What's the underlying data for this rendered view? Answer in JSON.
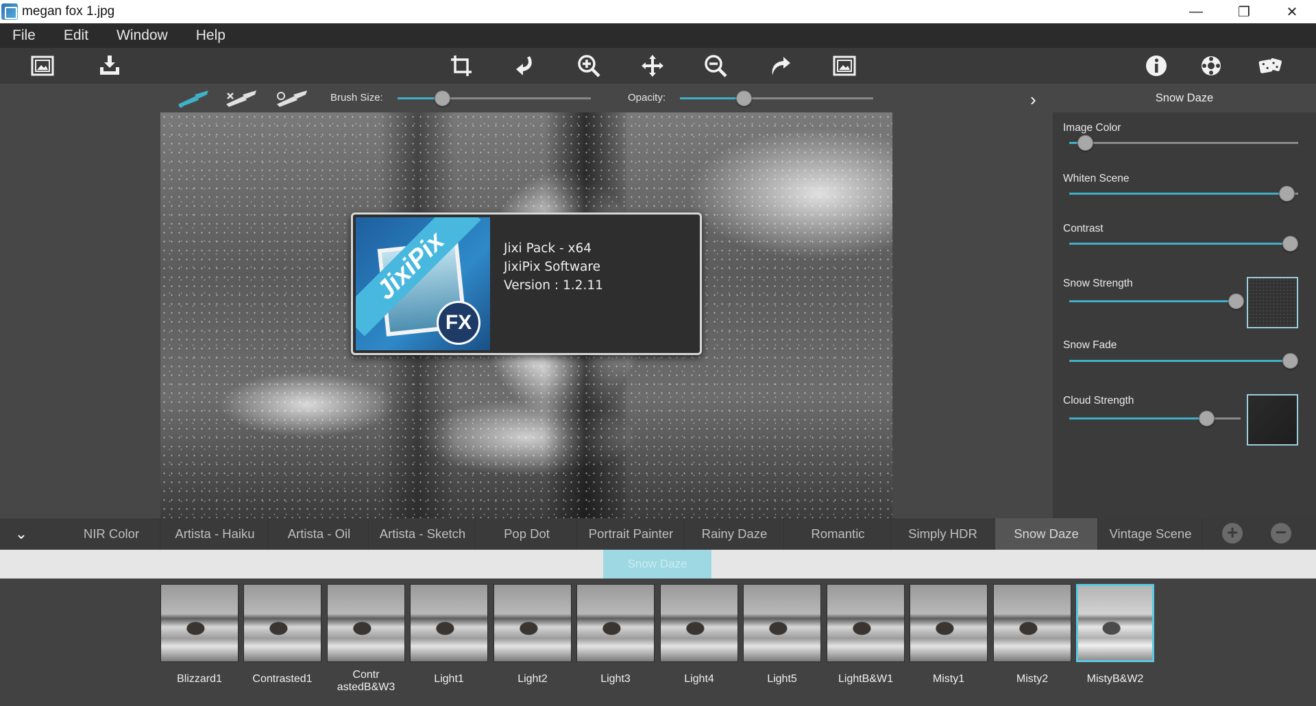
{
  "window": {
    "title": "megan fox 1.jpg",
    "controls": [
      "—",
      "❐",
      "✕"
    ]
  },
  "menu": {
    "items": [
      "File",
      "Edit",
      "Window",
      "Help"
    ]
  },
  "toolbar": {
    "left_icons": [
      "open-image-icon",
      "save-image-icon"
    ],
    "center_icons": [
      "crop-icon",
      "undo-icon",
      "zoom-in-icon",
      "pan-icon",
      "zoom-out-icon",
      "redo-icon",
      "fit-image-icon"
    ],
    "right_icons": [
      "info-icon",
      "settings-icon",
      "random-dice-icon"
    ]
  },
  "brushbar": {
    "brush_size_label": "Brush Size:",
    "brush_size_value": 0.23,
    "opacity_label": "Opacity:",
    "opacity_value": 0.33
  },
  "about": {
    "logo_text": "JixiPix",
    "logo_badge": "FX",
    "line1": "Jixi Pack - x64",
    "line2": "JixiPix Software",
    "line3": "Version : 1.2.11"
  },
  "panel": {
    "title": "Snow Daze",
    "sliders": [
      {
        "label": "Image Color",
        "value": 0.07
      },
      {
        "label": "Whiten Scene",
        "value": 0.95
      },
      {
        "label": "Contrast",
        "value": 1.0
      },
      {
        "label": "Snow Strength",
        "value": 0.97
      },
      {
        "label": "Snow Fade",
        "value": 1.0
      },
      {
        "label": "Cloud Strength",
        "value": 0.8
      }
    ]
  },
  "tabs": {
    "items": [
      "NIR Color",
      "Artista - Haiku",
      "Artista - Oil",
      "Artista - Sketch",
      "Pop Dot",
      "Portrait Painter",
      "Rainy Daze",
      "Romantic",
      "Simply HDR",
      "Snow Daze",
      "Vintage Scene"
    ],
    "active": "Snow Daze",
    "add": "+",
    "remove": "−"
  },
  "preset_group": "Snow Daze",
  "presets": {
    "items": [
      "Blizzard1",
      "Contrasted1",
      "Contr astedB&W3",
      "Light1",
      "Light2",
      "Light3",
      "Light4",
      "Light5",
      "LightB&W1",
      "Misty1",
      "Misty2",
      "MistyB&W2"
    ],
    "label_line1_2": "Contr",
    "label_line2_2": "astedB&W3",
    "selected": "MistyB&W2"
  },
  "colors": {
    "accent": "#3fb0c8",
    "selected_border": "#5cc9e0",
    "panel_bg": "#3b3b3b"
  }
}
